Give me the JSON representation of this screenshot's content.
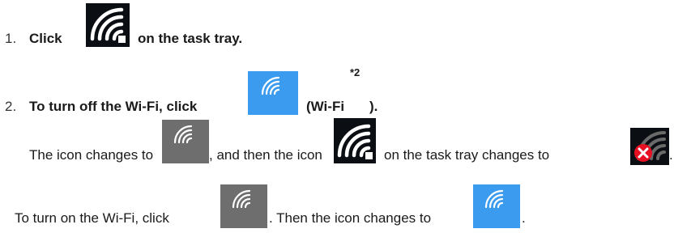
{
  "step1": {
    "number": "1.",
    "before": "Click",
    "after": "on the task tray."
  },
  "step2": {
    "number": "2.",
    "before": "To turn off the Wi-Fi, click",
    "after": "(Wi-Fi",
    "close": ").",
    "footnote": "*2"
  },
  "line3": {
    "part1": "The icon changes to",
    "part2": ", and then the icon",
    "part3": "on the task tray changes to",
    "part4": "."
  },
  "line4": {
    "part1": "To turn on the Wi-Fi, click",
    "part2": ". Then the icon changes to",
    "part3": "."
  },
  "icons": {
    "tray_wifi": "wifi-tray-icon",
    "quick_wifi_on": "wifi-quick-action-on-icon",
    "quick_wifi_off": "wifi-quick-action-off-icon",
    "tray_wifi_disabled": "wifi-disabled-tray-icon"
  },
  "colors": {
    "tray_bg": "#0b0f14",
    "on_blue": "#3b9bef",
    "off_gray": "#6e6e6e",
    "error_red": "#e81123"
  }
}
